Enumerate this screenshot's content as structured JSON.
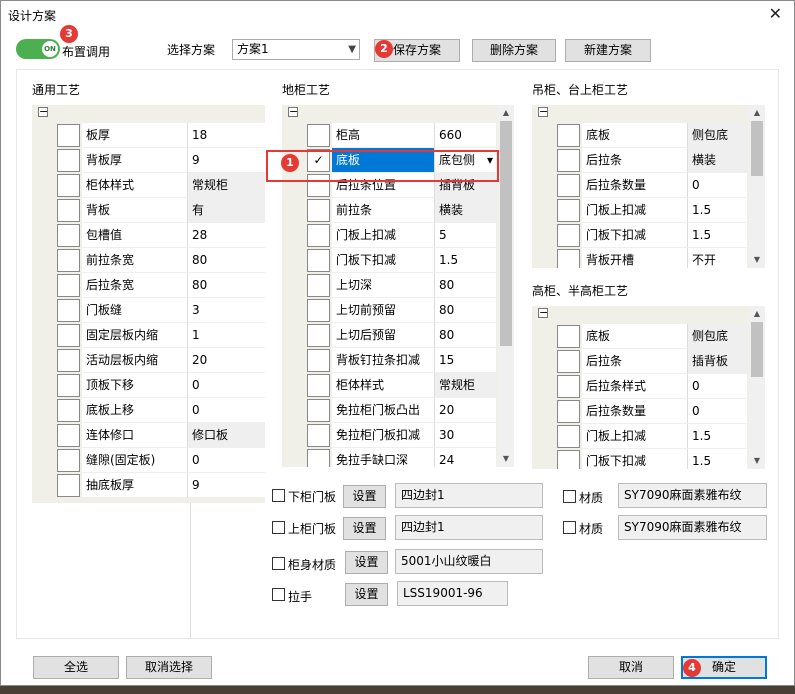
{
  "window": {
    "title": "设计方案",
    "close_glyph": "✕"
  },
  "toolbar": {
    "toggle_text": "ON",
    "layout_label": "布置调用",
    "scheme_label": "选择方案",
    "scheme_value": "方案1",
    "save_label": "保存方案",
    "delete_label": "删除方案",
    "new_label": "新建方案"
  },
  "sections": {
    "general": "通用工艺",
    "floor": "地柜工艺",
    "hanging": "吊柜、台上柜工艺",
    "tall": "高柜、半高柜工艺"
  },
  "general_rows": [
    {
      "name": "板厚",
      "value": "18"
    },
    {
      "name": "背板厚",
      "value": "9"
    },
    {
      "name": "柜体样式",
      "value": "常规柜"
    },
    {
      "name": "背板",
      "value": "有"
    },
    {
      "name": "包槽值",
      "value": "28"
    },
    {
      "name": "前拉条宽",
      "value": "80"
    },
    {
      "name": "后拉条宽",
      "value": "80"
    },
    {
      "name": "门板缝",
      "value": "3"
    },
    {
      "name": "固定层板内缩",
      "value": "1"
    },
    {
      "name": "活动层板内缩",
      "value": "20"
    },
    {
      "name": "顶板下移",
      "value": "0"
    },
    {
      "name": "底板上移",
      "value": "0"
    },
    {
      "name": "连体修口",
      "value": "修口板"
    },
    {
      "name": "缝隙(固定板)",
      "value": "0"
    },
    {
      "name": "抽底板厚",
      "value": "9"
    }
  ],
  "floor_rows": [
    {
      "name": "柜高",
      "value": "660"
    },
    {
      "name": "底板",
      "value": "底包侧"
    },
    {
      "name": "后拉条位置",
      "value": "插背板"
    },
    {
      "name": "前拉条",
      "value": "横装"
    },
    {
      "name": "门板上扣减",
      "value": "5"
    },
    {
      "name": "门板下扣减",
      "value": "1.5"
    },
    {
      "name": "上切深",
      "value": "80"
    },
    {
      "name": "上切前预留",
      "value": "80"
    },
    {
      "name": "上切后预留",
      "value": "80"
    },
    {
      "name": "背板钉拉条扣减",
      "value": "15"
    },
    {
      "name": "柜体样式",
      "value": "常规柜"
    },
    {
      "name": "免拉柜门板凸出",
      "value": "20"
    },
    {
      "name": "免拉柜门板扣减",
      "value": "30"
    },
    {
      "name": "免拉手缺口深",
      "value": "24"
    }
  ],
  "hanging_rows": [
    {
      "name": "底板",
      "value": "侧包底"
    },
    {
      "name": "后拉条",
      "value": "横装"
    },
    {
      "name": "后拉条数量",
      "value": "0"
    },
    {
      "name": "门板上扣减",
      "value": "1.5"
    },
    {
      "name": "门板下扣减",
      "value": "1.5"
    },
    {
      "name": "背板开槽",
      "value": "不开"
    }
  ],
  "tall_rows": [
    {
      "name": "底板",
      "value": "侧包底"
    },
    {
      "name": "后拉条",
      "value": "插背板"
    },
    {
      "name": "后拉条样式",
      "value": "0"
    },
    {
      "name": "后拉条数量",
      "value": "0"
    },
    {
      "name": "门板上扣减",
      "value": "1.5"
    },
    {
      "name": "门板下扣减",
      "value": "1.5"
    }
  ],
  "materials": {
    "lower_door": {
      "label": "下柜门板",
      "btn": "设置",
      "value": "四边封1"
    },
    "upper_door": {
      "label": "上柜门板",
      "btn": "设置",
      "value": "四边封1"
    },
    "body": {
      "label": "柜身材质",
      "btn": "设置",
      "value": "5001小山纹暖白"
    },
    "handle": {
      "label": "拉手",
      "btn": "设置",
      "value": "LSS19001-96"
    },
    "material1": {
      "label": "材质",
      "value": "SY7090麻面素雅布纹"
    },
    "material2": {
      "label": "材质",
      "value": "SY7090麻面素雅布纹"
    }
  },
  "footer": {
    "select_all": "全选",
    "deselect": "取消选择",
    "cancel": "取消",
    "ok": "确定"
  },
  "badges": [
    "1",
    "2",
    "3",
    "4"
  ],
  "colors": {
    "accent": "#0078d7",
    "badge": "#e53935",
    "toggle": "#4caf50"
  }
}
